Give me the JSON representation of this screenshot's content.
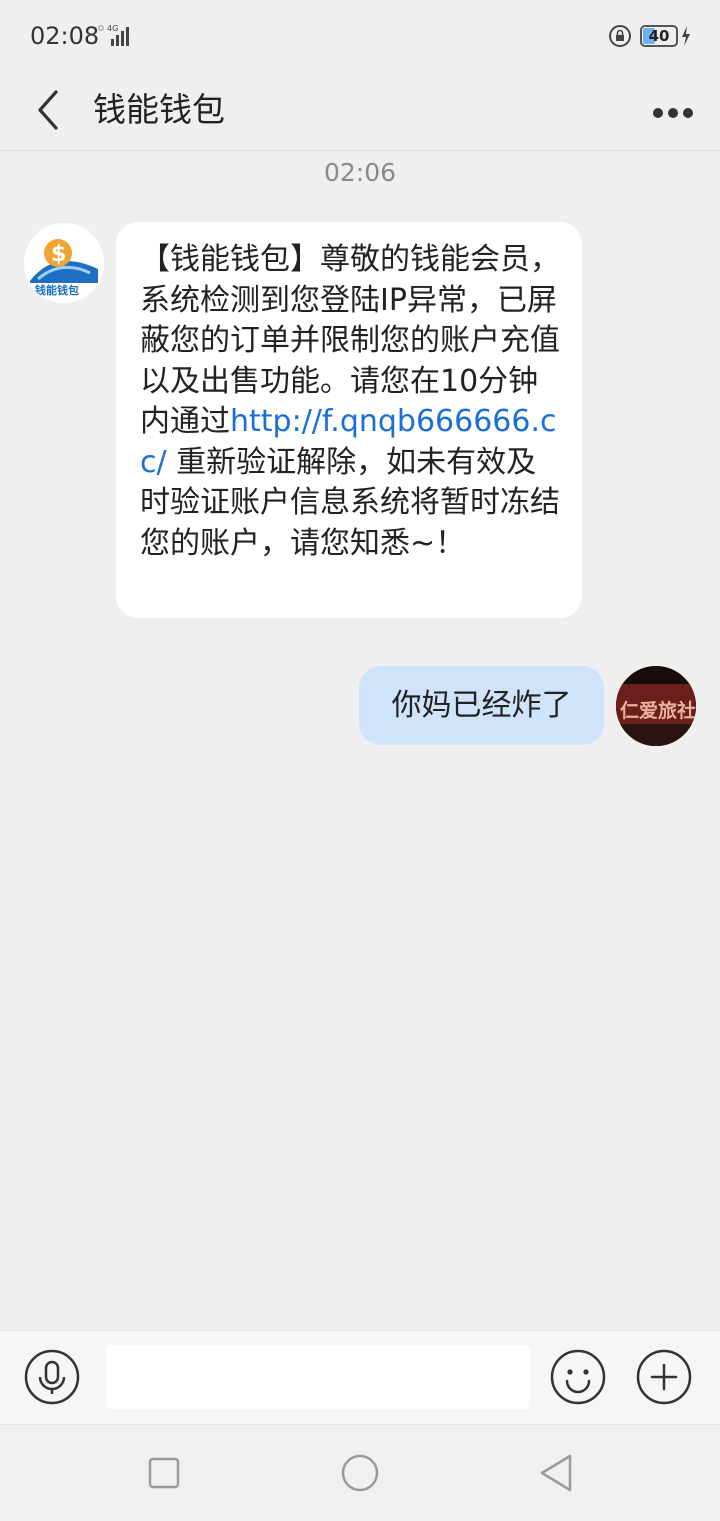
{
  "status_bar": {
    "time": "02:08",
    "network": "4G",
    "battery": "40",
    "battery_level_percent": 40
  },
  "header": {
    "title": "钱能钱包",
    "back_icon": "chevron-left-icon",
    "more_icon": "more-horizontal-icon"
  },
  "conversation": {
    "timestamp": "02:06",
    "incoming": {
      "sender_avatar_text": "钱能钱包",
      "text_before_link": "【钱能钱包】尊敬的钱能会员，系统检测到您登陆IP异常，已屏蔽您的订单并限制您的账户充值以及出售功能。请您在10分钟内通过",
      "link": "http://f.qnqb666666.cc/",
      "text_after_link": " 重新验证解除，如未有效及时验证账户信息系统将暂时冻结您的账户，请您知悉~！"
    },
    "outgoing": {
      "text": "你妈已经炸了",
      "avatar_text": "仁爱旅社"
    }
  },
  "input_bar": {
    "value": "",
    "mic_icon": "microphone-icon",
    "emoji_icon": "smiley-icon",
    "plus_icon": "plus-icon"
  },
  "system_nav": {
    "recents_icon": "square-icon",
    "home_icon": "circle-icon",
    "back_icon": "triangle-back-icon"
  }
}
